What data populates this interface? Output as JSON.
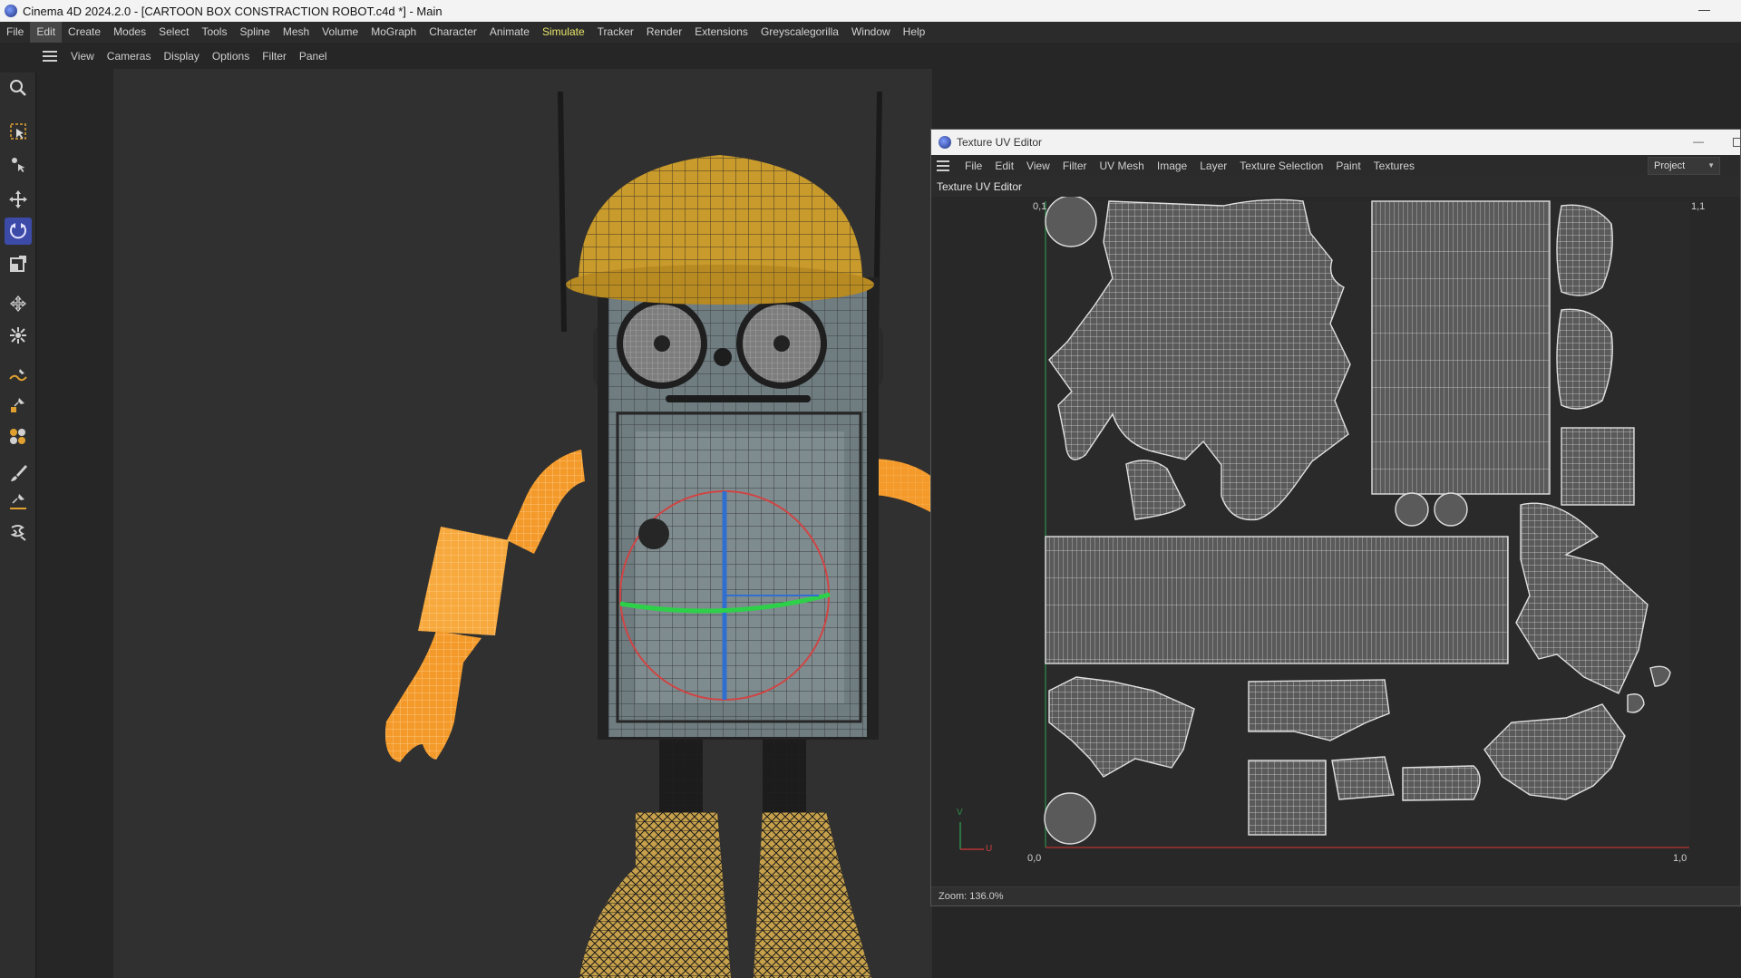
{
  "window": {
    "title": "Cinema 4D 2024.2.0 - [CARTOON BOX CONSTRACTION ROBOT.c4d *] - Main",
    "minimize_glyph": "—"
  },
  "menubar": {
    "items": [
      "File",
      "Edit",
      "Create",
      "Modes",
      "Select",
      "Tools",
      "Spline",
      "Mesh",
      "Volume",
      "MoGraph",
      "Character",
      "Animate",
      "Simulate",
      "Tracker",
      "Render",
      "Extensions",
      "Greyscalegorilla",
      "Window",
      "Help"
    ],
    "active": "Edit",
    "highlight": "Simulate"
  },
  "viewport_menu": {
    "items": [
      "View",
      "Cameras",
      "Display",
      "Options",
      "Filter",
      "Panel"
    ]
  },
  "tools": [
    "search-icon",
    "live-selection-icon",
    "transform-icon",
    "move-icon",
    "rotate-icon",
    "scale-icon",
    "axis-move-icon",
    "multi-transform-icon",
    "spline-pen-icon",
    "spline-sketch-icon",
    "polygon-pen-icon",
    "brush-icon",
    "knife-icon",
    "line-cut-icon",
    "magnet-icon"
  ],
  "uv_editor": {
    "title": "Texture UV Editor",
    "menu": [
      "File",
      "Edit",
      "View",
      "Filter",
      "UV Mesh",
      "Image",
      "Layer",
      "Texture Selection",
      "Paint",
      "Textures"
    ],
    "project_select": "Project",
    "panel_label": "Texture UV Editor",
    "axis": {
      "top_left": "0,1",
      "top_right": "1,1",
      "origin": "0,0",
      "right": "1,0",
      "v": "V",
      "u": "U"
    },
    "zoom": "Zoom: 136.0%"
  },
  "colors": {
    "accent_selected": "#3c4aa8",
    "simulate": "#e8e46a",
    "helmet": "#c99a2c",
    "arm": "#f49a2a",
    "body": "#6f7c80"
  }
}
